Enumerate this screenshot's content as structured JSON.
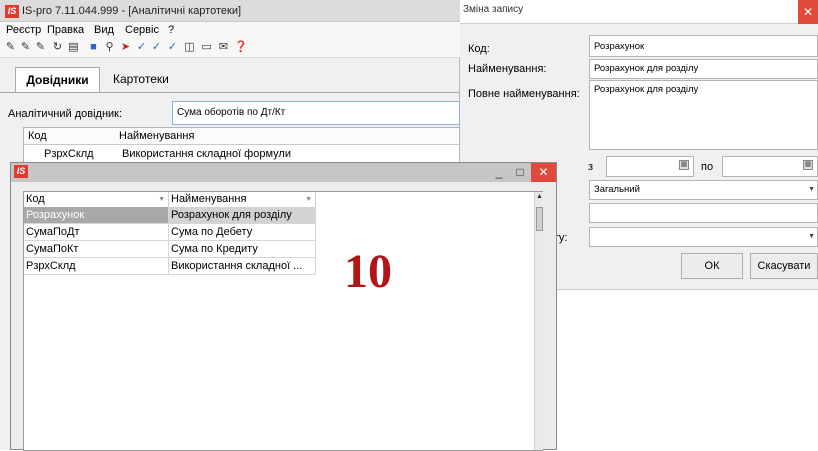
{
  "main_window": {
    "title": "IS-pro 7.11.044.999 - [Аналітичні картотеки]",
    "logo_text": "IS",
    "menu": [
      "Реєстр",
      "Правка",
      "Вид",
      "Сервіс",
      "?"
    ],
    "toolbar_icons": [
      "new-icon",
      "copy-icon",
      "new-child-icon",
      "refresh-icon",
      "print-icon",
      "book-icon",
      "search-icon",
      "arrow-icon",
      "check-icon",
      "double-check-icon",
      "check-partial-icon",
      "columns-icon",
      "document-icon",
      "mail-icon",
      "help-icon"
    ],
    "tabs": [
      "Довідники",
      "Картотеки"
    ],
    "active_tab": "Довідники",
    "analytic_label": "Аналітичний довідник:",
    "analytic_value": "Сума оборотів по Дт/Кт",
    "table": {
      "headers": [
        "Код",
        "Найменування"
      ],
      "rows": [
        [
          "РзрхСклд",
          "Використання складної формули"
        ]
      ]
    }
  },
  "dialog": {
    "title": "Зміна запису",
    "fields": {
      "code_label": "Код:",
      "code_value": "Розрахунок",
      "name_label": "Найменування:",
      "name_value": "Розрахунок для розділу",
      "full_name_label": "Повне найменування:",
      "full_name_value": "Розрахунок для розділу",
      "from_label": "з",
      "to_label": "по",
      "type_value": "Загальний",
      "extra_value": "",
      "partial_label": "ету:",
      "partial_value": ""
    },
    "buttons": {
      "ok": "ОК",
      "cancel": "Скасувати"
    }
  },
  "popup": {
    "logo_text": "IS",
    "controls": {
      "minimize": "_",
      "maximize": "□",
      "close": "✕"
    },
    "columns": [
      "Код",
      "Найменування"
    ],
    "rows": [
      {
        "code": "Розрахунок",
        "name": "Розрахунок для розділу",
        "selected": true
      },
      {
        "code": "СумаПоДт",
        "name": "Сума по Дебету",
        "selected": false
      },
      {
        "code": "СумаПоКт",
        "name": "Сума по Кредиту",
        "selected": false
      },
      {
        "code": "РзрхСклд",
        "name": "Використання складної ...",
        "selected": false
      }
    ],
    "step_number": "10"
  },
  "colors": {
    "accent": "#2a63c4",
    "close": "#e04a3a",
    "step_number": "#b21515",
    "selection": "#a8a8a8"
  }
}
